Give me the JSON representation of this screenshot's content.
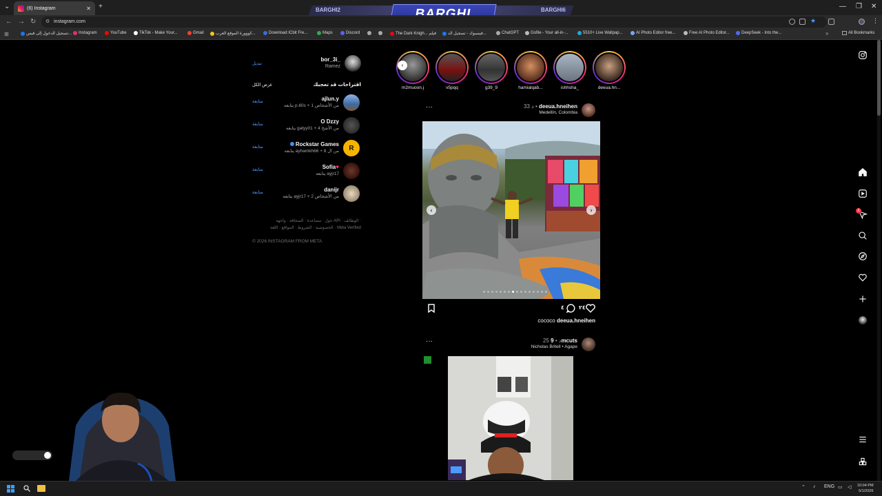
{
  "browser": {
    "tab_title": "(6) Instagram",
    "new_tab_label": "+",
    "url": "instagram.com",
    "banner_title": "BARGHI",
    "banner_left": "BARGHI2",
    "banner_right": "BARGHI6",
    "all_bookmarks_label": "All Bookmarks",
    "bookmarks": [
      "تسجيل الدخول إلى فيس...",
      "Instagram",
      "YouTube",
      "TikTok - Make Your...",
      "Gmail",
      "كووورة الموقع العرب...",
      "Download ICbit Fre...",
      "Maps",
      "Discord",
      "The Dark Knigh... فيلم",
      "فيسبوك - تسجيل الد...",
      "ChatGPT",
      "Gofile - Your all-in-...",
      "5510+ Live Wallpap...",
      "AI Photo Editor free...",
      "Free AI Photo Editor...",
      "DeepSeek - Into the..."
    ],
    "bookmark_colors": [
      "#1877f2",
      "#e1306c",
      "#ff0000",
      "#ffffff",
      "#ea4335",
      "#f5c518",
      "#3b6fd6",
      "#34a853",
      "#5865f2",
      "#aaaaaa",
      "#aaaaaa",
      "#e50914",
      "#1877f2",
      "#aaaaaa",
      "#bbbbbb",
      "#23a6d5",
      "#7aa5ff",
      "#bbbbbb",
      "#4d6bfe"
    ]
  },
  "current_user": {
    "username": "bor_3i_",
    "full_name": "Ramez",
    "switch_label": "تبديل"
  },
  "suggestions": {
    "title": "اقتراحات قد تعجبك",
    "see_all_label": "عرض الكل",
    "follow_label": "متابعة",
    "items": [
      {
        "username": "ajlun.y",
        "subtitle": "يتابعه p.60s + 1 من الأشخاص",
        "color": "#5a7fb8"
      },
      {
        "username": "O Dzzy",
        "subtitle": "يتابعه gatyy01 + 4 من الأشخ",
        "color": "#3a3a3a"
      },
      {
        "username": "Rockstar Games",
        "subtitle": "يتابعه ayhamkh66 + 8 من ال",
        "color": "#f5b400"
      },
      {
        "username": "Sofia",
        "subtitle": "يتابعه ayjr17",
        "color": "#5a3a2a"
      },
      {
        "username": "danijr",
        "subtitle": "يتابعه ayjr17 + 2 من الأشخاص",
        "color": "#c8b89a"
      }
    ]
  },
  "footer": {
    "links_line1": "حول · مساعدة · الصحافة · واجهة API · الوظائف ·",
    "links_line2": "الخصوصية · الشروط · المواقع · اللغة · Meta Verified",
    "copyright": "© 2026 INSTAGRAM FROM META"
  },
  "stories": [
    {
      "name": "m2muoon.j",
      "color": "#555555"
    },
    {
      "name": "v5pqq",
      "color": "#7a1010"
    },
    {
      "name": "g39_9",
      "color": "#4a4a4a"
    },
    {
      "name": "hamialqab...",
      "color": "#b07040"
    },
    {
      "name": "ishhsha_",
      "color": "#8a9aa8"
    },
    {
      "name": "deeua.hn...",
      "color": "#6a5a4a"
    }
  ],
  "posts": [
    {
      "username": "deeua.hneihen",
      "time": "33 د",
      "location": "Medellín, Colombia",
      "comments_count": "٤",
      "likes_count": "٢٤",
      "caption_user": "deeua.hneihen",
      "caption": "cococo",
      "avatar_color": "#8a6a5a"
    },
    {
      "username": "9mcuts",
      "time": "25 د",
      "location": "Nicholas Britell • Agape",
      "avatar_color": "#7a5a4a"
    }
  ],
  "taskbar": {
    "language": "ENG",
    "time": "10:04 PM",
    "date": "5/1/2026"
  },
  "nav_icons": [
    "instagram-logo-icon",
    "home-icon",
    "reels-icon",
    "messages-icon",
    "search-icon",
    "explore-icon",
    "notifications-icon",
    "create-icon",
    "profile-icon",
    "more-menu-icon",
    "also-from-meta-icon"
  ],
  "messages_badge": "6"
}
